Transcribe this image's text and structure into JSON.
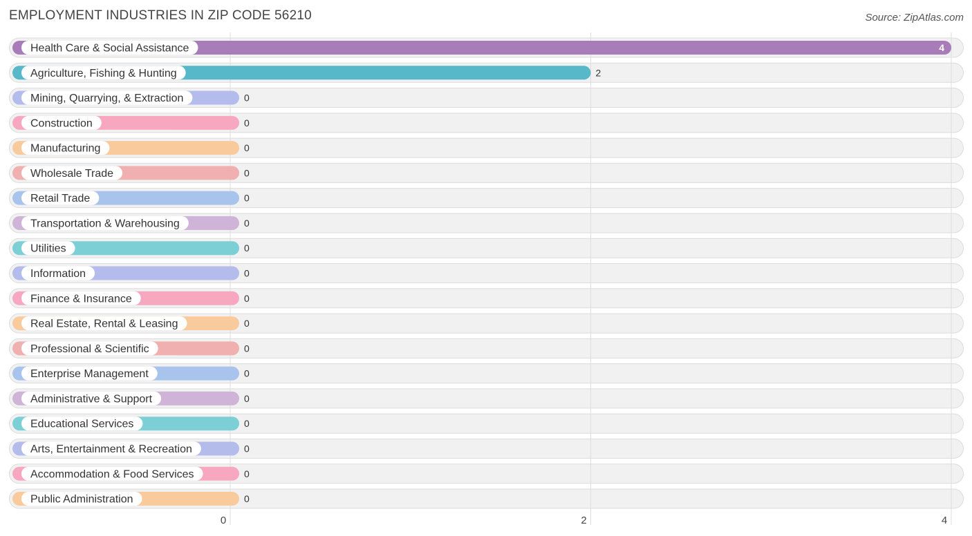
{
  "header": {
    "title": "EMPLOYMENT INDUSTRIES IN ZIP CODE 56210",
    "source": "Source: ZipAtlas.com"
  },
  "chart_data": {
    "type": "bar",
    "orientation": "horizontal",
    "title": "EMPLOYMENT INDUSTRIES IN ZIP CODE 56210",
    "xlabel": "",
    "ylabel": "",
    "xlim": [
      0,
      4
    ],
    "ticks": [
      "0",
      "2",
      "4"
    ],
    "grid": true,
    "categories": [
      "Health Care & Social Assistance",
      "Agriculture, Fishing & Hunting",
      "Mining, Quarrying, & Extraction",
      "Construction",
      "Manufacturing",
      "Wholesale Trade",
      "Retail Trade",
      "Transportation & Warehousing",
      "Utilities",
      "Information",
      "Finance & Insurance",
      "Real Estate, Rental & Leasing",
      "Professional & Scientific",
      "Enterprise Management",
      "Administrative & Support",
      "Educational Services",
      "Arts, Entertainment & Recreation",
      "Accommodation & Food Services",
      "Public Administration"
    ],
    "values": [
      4,
      2,
      0,
      0,
      0,
      0,
      0,
      0,
      0,
      0,
      0,
      0,
      0,
      0,
      0,
      0,
      0,
      0,
      0
    ],
    "value_labels": [
      "4",
      "2",
      "0",
      "0",
      "0",
      "0",
      "0",
      "0",
      "0",
      "0",
      "0",
      "0",
      "0",
      "0",
      "0",
      "0",
      "0",
      "0",
      "0"
    ],
    "colors": [
      "#a87cb8",
      "#56b8c8",
      "#b4bcec",
      "#f7a8c0",
      "#f9cb9c",
      "#f0b0b0",
      "#a8c4ec",
      "#d0b4d8",
      "#7ccfd4",
      "#b4bcec",
      "#f7a8c0",
      "#f9cb9c",
      "#f0b0b0",
      "#a8c4ec",
      "#d0b4d8",
      "#7ccfd4",
      "#b4bcec",
      "#f7a8c0",
      "#f9cb9c"
    ]
  }
}
